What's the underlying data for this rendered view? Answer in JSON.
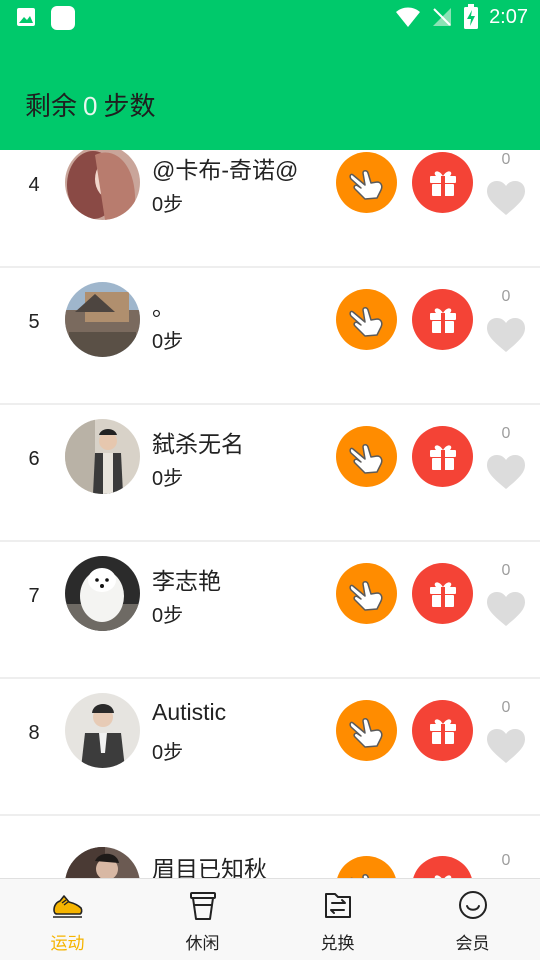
{
  "status_bar": {
    "time": "2:07"
  },
  "header": {
    "prefix": "剩余",
    "steps_value": "0",
    "suffix": "步数"
  },
  "rows": [
    {
      "rank": "4",
      "name": "@卡布-奇诺@",
      "steps": "0步",
      "likes": "0"
    },
    {
      "rank": "5",
      "name": "。",
      "steps": "0步",
      "likes": "0"
    },
    {
      "rank": "6",
      "name": "弑杀无名",
      "steps": "0步",
      "likes": "0"
    },
    {
      "rank": "7",
      "name": "李志艳",
      "steps": "0步",
      "likes": "0"
    },
    {
      "rank": "8",
      "name": "Autistic",
      "steps": "0步",
      "likes": "0"
    },
    {
      "rank": "",
      "name": "眉目已知秋",
      "steps": "",
      "likes": "0"
    }
  ],
  "tabs": [
    {
      "label": "运动",
      "icon": "running-shoe-icon",
      "active": true
    },
    {
      "label": "休闲",
      "icon": "coffee-cup-icon",
      "active": false
    },
    {
      "label": "兑换",
      "icon": "exchange-doc-icon",
      "active": false
    },
    {
      "label": "会员",
      "icon": "smile-face-icon",
      "active": false
    }
  ],
  "colors": {
    "primary_green": "#00c96b",
    "poke_orange": "#ff8c00",
    "gift_red": "#f44336",
    "active_tab": "#f5b400"
  }
}
